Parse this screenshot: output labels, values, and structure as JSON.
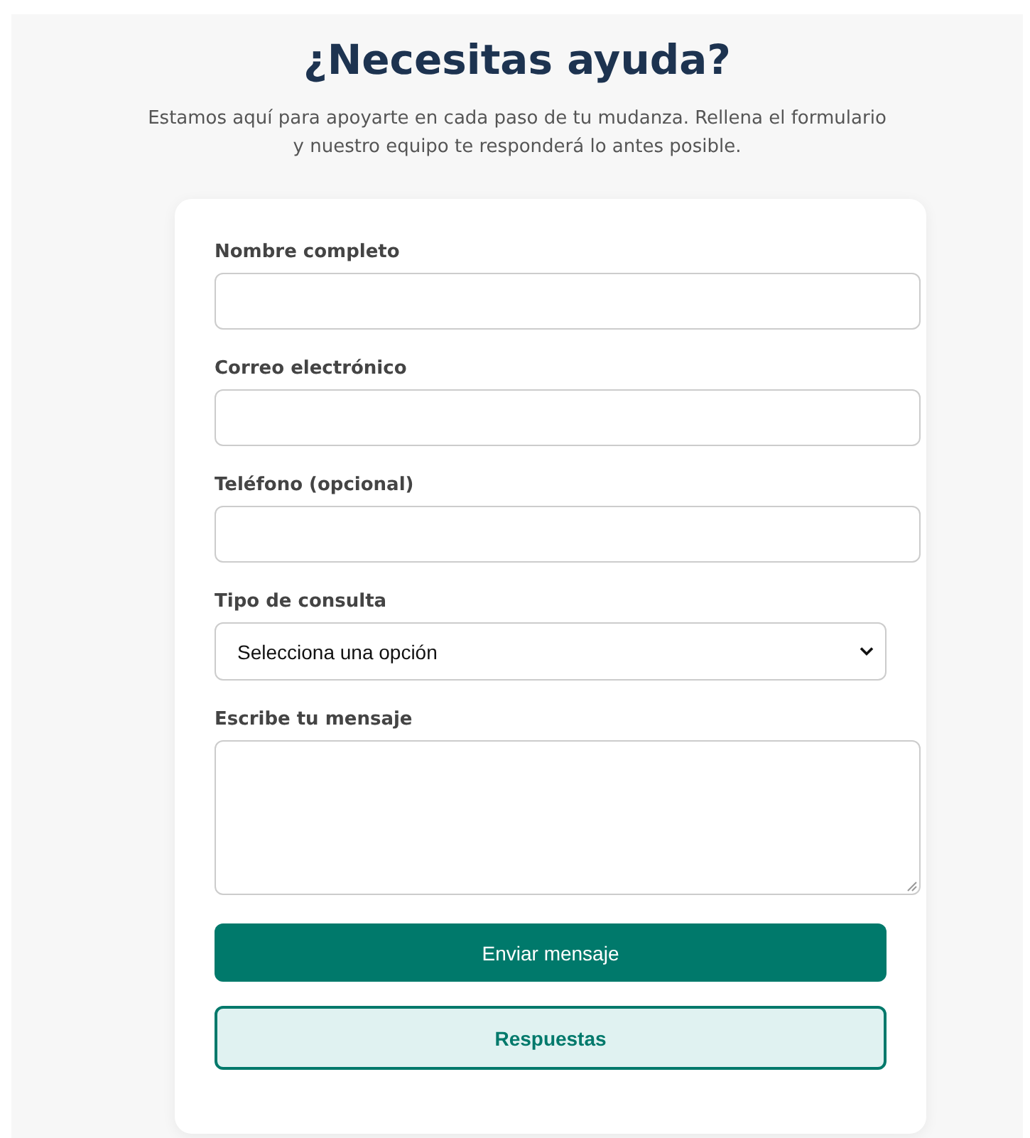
{
  "title": "¿Necesitas ayuda?",
  "subtitle": "Estamos aquí para apoyarte en cada paso de tu mudanza. Rellena el formulario y nuestro equipo te responderá lo antes posible.",
  "form": {
    "fields": [
      {
        "kind": "text",
        "label": "Nombre completo"
      },
      {
        "kind": "text",
        "label": "Correo electrónico"
      },
      {
        "kind": "text",
        "label": "Teléfono (opcional)"
      },
      {
        "kind": "select",
        "label": "Tipo de consulta",
        "value": "Selecciona una opción"
      },
      {
        "kind": "textarea",
        "label": "Escribe tu mensaje"
      }
    ],
    "buttons": [
      {
        "kind": "primary",
        "label": "Enviar mensaje"
      },
      {
        "kind": "outline",
        "label": "Respuestas"
      }
    ]
  }
}
